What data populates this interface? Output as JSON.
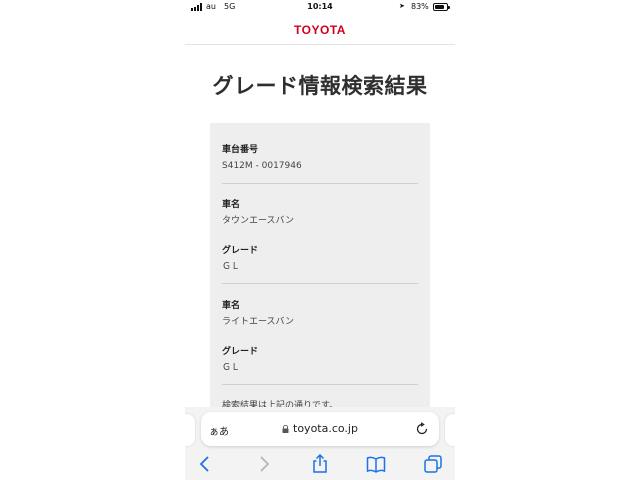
{
  "status_bar": {
    "carrier": "au",
    "network": "5G",
    "time": "10:14",
    "battery_percent": "83%",
    "battery_level": 0.83
  },
  "header": {
    "logo": "TOYOTA",
    "brand_color": "#d2001d"
  },
  "page": {
    "title": "グレード情報検索結果"
  },
  "result": {
    "chassis_label": "車台番号",
    "chassis_value": "S412M - 0017946",
    "entries": [
      {
        "name_label": "車名",
        "name_value": "タウンエースバン",
        "grade_label": "グレード",
        "grade_value": "ＧＬ"
      },
      {
        "name_label": "車名",
        "name_value": "ライトエースバン",
        "grade_label": "グレード",
        "grade_value": "ＧＬ"
      }
    ],
    "note": "検索結果は上記の通りです。"
  },
  "browser": {
    "aa_label": "ぁあ",
    "url": "toyota.co.jp",
    "accent_color": "#1a73e8",
    "icons": [
      "back-icon",
      "forward-icon",
      "share-icon",
      "bookmarks-icon",
      "tabs-icon",
      "lock-icon",
      "reload-icon"
    ]
  }
}
